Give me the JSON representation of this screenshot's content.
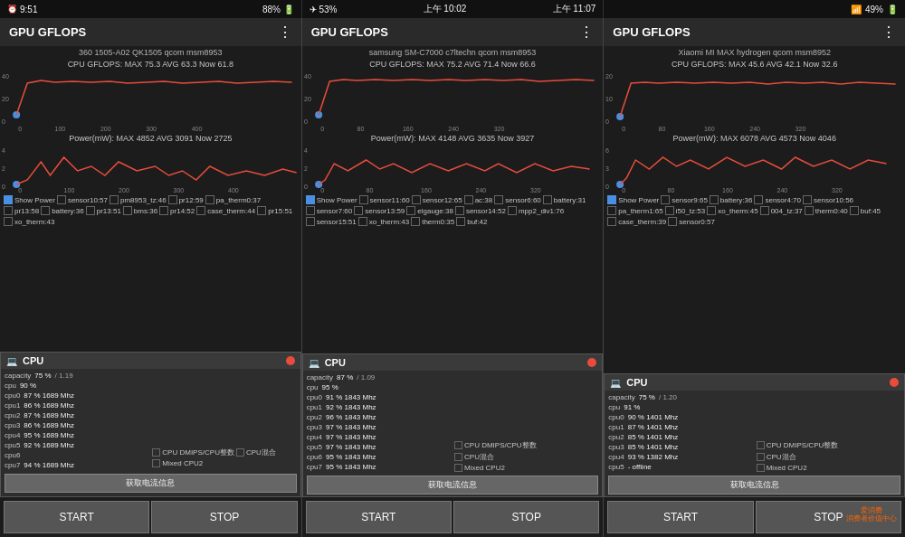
{
  "statusBars": [
    {
      "left": "9:51",
      "leftIcons": [
        "alarm-icon",
        "wifi-icon"
      ],
      "right": "88%",
      "rightExtra": ""
    },
    {
      "left": "53%",
      "centerTime": "上午 10:02",
      "right": "上午 11:07"
    },
    {
      "left": "",
      "rightIcons": [
        "signal-icon"
      ],
      "right": "49%"
    }
  ],
  "panels": [
    {
      "id": "panel1",
      "title": "GPU GFLOPS",
      "device": "360 1505-A02 QK1505 qcom msm8953",
      "cpuGflops": "CPU GFLOPS: MAX 75.3 AVG 63.3 Now 61.8",
      "powerInfo": "Power(mW): MAX 4852 AVG 3091 Now 2725",
      "showPower": true,
      "checkboxes": [
        {
          "label": "sensor10:57",
          "checked": false
        },
        {
          "label": "pm8953_tz:46",
          "checked": false
        },
        {
          "label": "pr12:59",
          "checked": false
        },
        {
          "label": "pa_therm0:37",
          "checked": false
        },
        {
          "label": "pr13:58",
          "checked": false
        },
        {
          "label": "battery:36",
          "checked": false
        },
        {
          "label": "pr13:51",
          "checked": false
        },
        {
          "label": "bms:36",
          "checked": false
        },
        {
          "label": "pr14:52",
          "checked": false
        },
        {
          "label": "case_therm:44",
          "checked": false
        },
        {
          "label": "pr15:51",
          "checked": false
        },
        {
          "label": "xo_therm:43",
          "checked": false
        }
      ],
      "cpu": {
        "capacity": "75 %",
        "capacityExtra": "/ 1.19",
        "rows": [
          {
            "label": "cpu",
            "val": "90 %"
          },
          {
            "label": "cpu0",
            "val": "87 % 1689 Mhz"
          },
          {
            "label": "cpu1",
            "val": "86 % 1689 Mhz"
          },
          {
            "label": "cpu2",
            "val": "87 % 1689 Mhz"
          },
          {
            "label": "cpu3",
            "val": "86 % 1689 Mhz"
          },
          {
            "label": "cpu4",
            "val": "95 % 1689 Mhz"
          },
          {
            "label": "cpu5",
            "val": "92 % 1689 Mhz"
          },
          {
            "label": "cpu6",
            "val": ""
          },
          {
            "label": "cpu7",
            "val": "94 % 1689 Mhz"
          }
        ]
      },
      "extraCheckboxes": [
        {
          "label": "CPU DMIPS/CPU整数",
          "checked": false
        },
        {
          "label": "CPU混合",
          "checked": false
        },
        {
          "label": "Mixed CPU2",
          "checked": false
        }
      ],
      "btnStart": "START",
      "btnStop": "STOP"
    },
    {
      "id": "panel2",
      "title": "GPU GFLOPS",
      "device": "samsung SM-C7000 c7ltechn qcom msm8953",
      "cpuGflops": "CPU GFLOPS: MAX 75.2 AVG 71.4 Now 66.6",
      "powerInfo": "Power(mW): MAX 4148 AVG 3635 Now 3927",
      "showPower": true,
      "checkboxes": [
        {
          "label": "sensor11:60",
          "checked": false
        },
        {
          "label": "ac:38",
          "checked": false
        },
        {
          "label": "sensor6:60",
          "checked": false
        },
        {
          "label": "sensor12:65",
          "checked": false
        },
        {
          "label": "battery:31",
          "checked": false
        },
        {
          "label": "sensor7:60",
          "checked": false
        },
        {
          "label": "sensor13:59",
          "checked": false
        },
        {
          "label": "elgauge:38",
          "checked": false
        },
        {
          "label": "sensor14:52",
          "checked": false
        },
        {
          "label": "mpp2_div1:76",
          "checked": false
        },
        {
          "label": "sensor15:51",
          "checked": false
        },
        {
          "label": "xo_therm:43",
          "checked": false
        },
        {
          "label": "therm0:35",
          "checked": false
        },
        {
          "label": "buf:42",
          "checked": false
        }
      ],
      "cpu": {
        "capacity": "87 %",
        "capacityExtra": "/ 1.09",
        "rows": [
          {
            "label": "cpu",
            "val": "95 %"
          },
          {
            "label": "cpu0",
            "val": "91 % 1843 Mhz"
          },
          {
            "label": "cpu1",
            "val": "92 % 1843 Mhz"
          },
          {
            "label": "cpu2",
            "val": "96 % 1843 Mhz"
          },
          {
            "label": "cpu3",
            "val": "97 % 1843 Mhz"
          },
          {
            "label": "cpu4",
            "val": "97 % 1843 Mhz"
          },
          {
            "label": "cpu5",
            "val": "97 % 1843 Mhz"
          },
          {
            "label": "cpu6",
            "val": "95 % 1843 Mhz"
          },
          {
            "label": "cpu7",
            "val": "95 % 1843 Mhz"
          }
        ]
      },
      "extraCheckboxes": [
        {
          "label": "获取电流信息",
          "checked": false
        },
        {
          "label": "CPU DMIPS/CPU整数",
          "checked": false
        },
        {
          "label": "CPU混合",
          "checked": false
        },
        {
          "label": "Mixed CPU2",
          "checked": false
        }
      ],
      "btnStart": "START",
      "btnStop": "STOP"
    },
    {
      "id": "panel3",
      "title": "GPU GFLOPS",
      "device": "Xiaomi MI MAX hydrogen qcom msm8952",
      "cpuGflops": "CPU GFLOPS: MAX 45.6 AVG 42.1 Now 32.6",
      "powerInfo": "Power(mW): MAX 6078 AVG 4573 Now 4046",
      "showPower": true,
      "checkboxes": [
        {
          "label": "sensor9:65",
          "checked": false
        },
        {
          "label": "battery:36",
          "checked": false
        },
        {
          "label": "sensor4:70",
          "checked": false
        },
        {
          "label": "sensor10:56",
          "checked": false
        },
        {
          "label": "pa_therm1:65",
          "checked": false
        },
        {
          "label": "i50_tz:53",
          "checked": false
        },
        {
          "label": "xo_therm:45",
          "checked": false
        },
        {
          "label": "004_tz:37",
          "checked": false
        },
        {
          "label": "therm0:40",
          "checked": false
        },
        {
          "label": "buf:45",
          "checked": false
        },
        {
          "label": "case_therm:39",
          "checked": false
        },
        {
          "label": "sensor0:57",
          "checked": false
        }
      ],
      "cpu": {
        "capacity": "75 %",
        "capacityExtra": "/ 1.20",
        "rows": [
          {
            "label": "cpu",
            "val": "91 %"
          },
          {
            "label": "cpu0",
            "val": "90 % 1401 Mhz"
          },
          {
            "label": "cpu1",
            "val": "87 % 1401 Mhz"
          },
          {
            "label": "cpu2",
            "val": "85 % 1401 Mhz"
          },
          {
            "label": "cpu3",
            "val": "85 % 1401 Mhz"
          },
          {
            "label": "cpu4",
            "val": "93 % 1382 Mhz"
          },
          {
            "label": "cpu5",
            "val": "- offline"
          }
        ]
      },
      "extraCheckboxes": [
        {
          "label": "获取电流信息",
          "checked": false
        },
        {
          "label": "CPU DMIPS/CPU整数",
          "checked": false
        },
        {
          "label": "CPU混合",
          "checked": false
        },
        {
          "label": "Mixed CPU2",
          "checked": false
        }
      ],
      "btnStart": "START",
      "btnStop": "STOP"
    }
  ],
  "watermark": {
    "line1": "爱消费",
    "line2": "消费者价值中心"
  }
}
